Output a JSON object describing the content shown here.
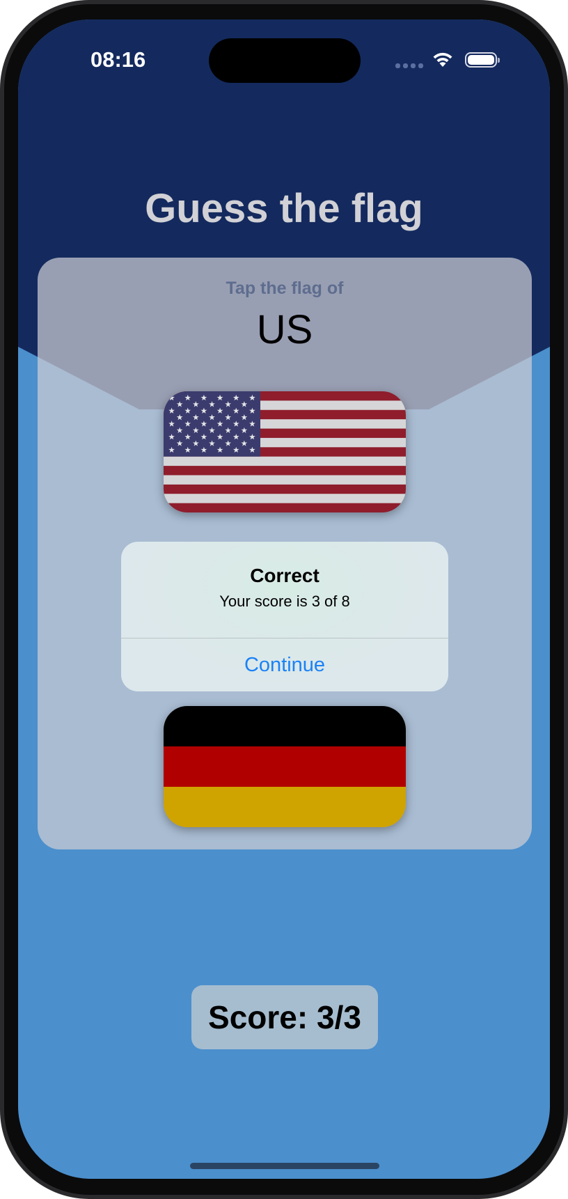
{
  "status_bar": {
    "time": "08:16",
    "icons": [
      "cellular-signal-icon",
      "wifi-icon",
      "battery-icon"
    ]
  },
  "app": {
    "title": "Guess the flag",
    "prompt_label": "Tap the flag of",
    "target_country": "US",
    "flags": [
      {
        "country": "US",
        "icon": "us-flag-icon"
      },
      {
        "country": "Germany",
        "icon": "germany-flag-icon"
      }
    ],
    "score_label": "Score: 3/3"
  },
  "alert": {
    "title": "Correct",
    "message": "Your score is 3 of 8",
    "button_label": "Continue"
  },
  "colors": {
    "background_dark": "#142a5e",
    "background_light": "#4b8fcd",
    "title_text": "#d1d1d6",
    "alert_button": "#1a82f6"
  }
}
